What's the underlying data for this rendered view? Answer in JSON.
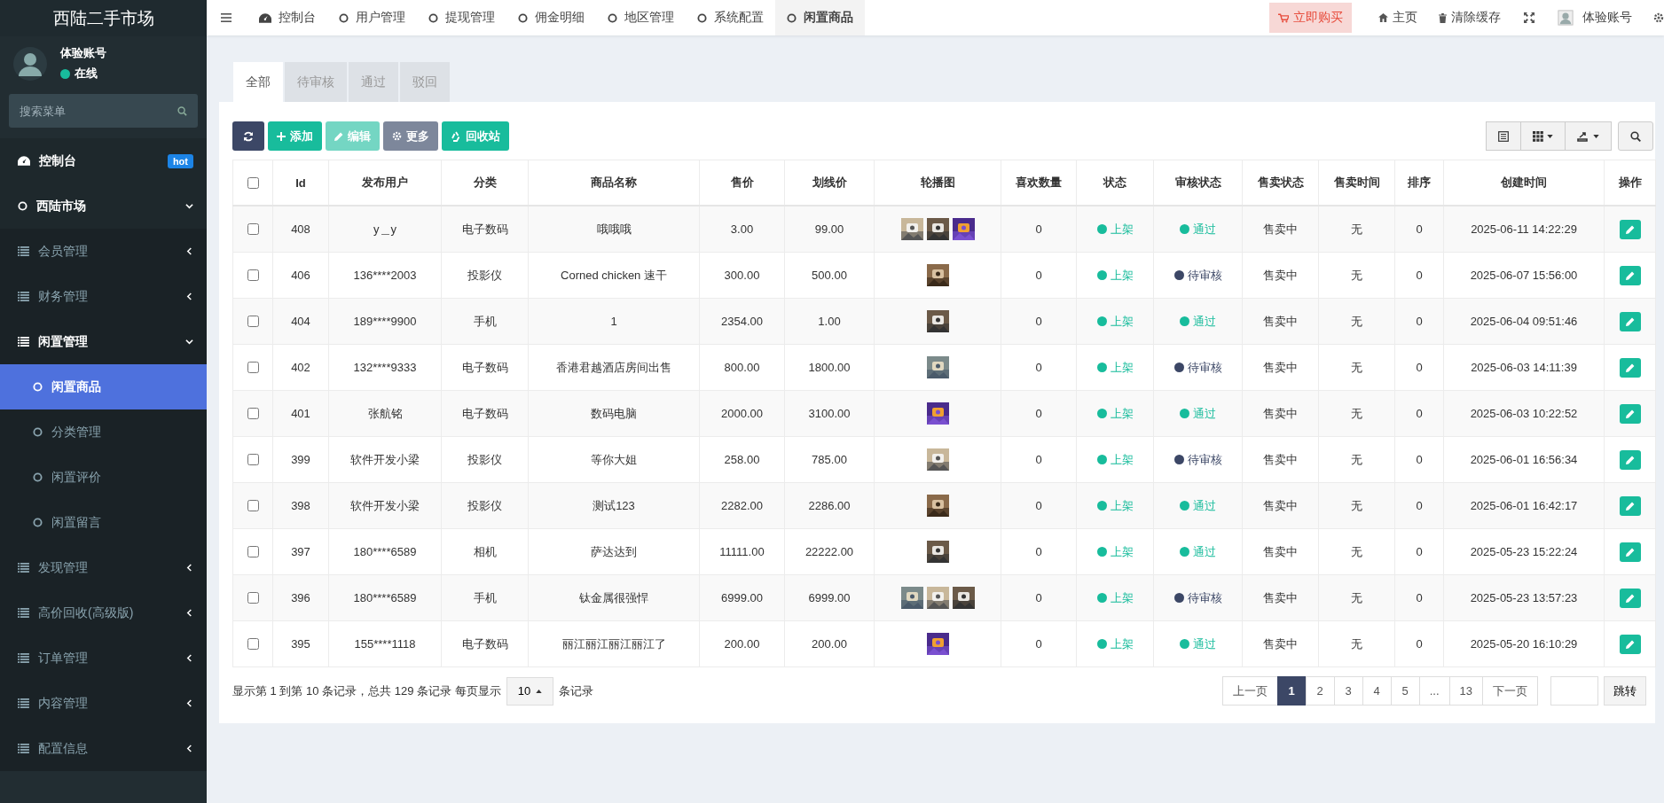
{
  "sidebar": {
    "brand": "西陆二手市场",
    "user": {
      "name": "体验账号",
      "status": "在线",
      "online": true
    },
    "search": {
      "placeholder": "搜索菜单"
    },
    "items": [
      {
        "label": "控制台",
        "badge": "hot",
        "selected": false
      },
      {
        "label": "西陆市场",
        "expanded": true,
        "selected": false,
        "children": [
          {
            "label": "会员管理",
            "expanded": false,
            "selected": false
          },
          {
            "label": "财务管理",
            "expanded": false,
            "selected": false
          },
          {
            "label": "闲置管理",
            "expanded": true,
            "selected": false,
            "children": [
              {
                "label": "闲置商品",
                "selected": true
              },
              {
                "label": "分类管理",
                "selected": false
              },
              {
                "label": "闲置评价",
                "selected": false
              },
              {
                "label": "闲置留言",
                "selected": false
              }
            ]
          },
          {
            "label": "发现管理",
            "expanded": false,
            "selected": false
          },
          {
            "label": "高价回收(高级版)",
            "expanded": false,
            "selected": false
          },
          {
            "label": "订单管理",
            "expanded": false,
            "selected": false
          },
          {
            "label": "内容管理",
            "expanded": false,
            "selected": false
          },
          {
            "label": "配置信息",
            "expanded": false,
            "selected": false
          }
        ]
      }
    ]
  },
  "top_nav": {
    "tabs": [
      {
        "label": "控制台",
        "selected": false
      },
      {
        "label": "用户管理",
        "selected": false
      },
      {
        "label": "提现管理",
        "selected": false
      },
      {
        "label": "佣金明细",
        "selected": false
      },
      {
        "label": "地区管理",
        "selected": false
      },
      {
        "label": "系统配置",
        "selected": false
      },
      {
        "label": "闲置商品",
        "selected": true
      }
    ],
    "buy_button": "立即购买",
    "home": "主页",
    "clear_cache": "清除缓存",
    "account": "体验账号"
  },
  "filter_tabs": [
    {
      "label": "全部",
      "selected": true
    },
    {
      "label": "待审核",
      "selected": false
    },
    {
      "label": "通过",
      "selected": false
    },
    {
      "label": "驳回",
      "selected": false
    }
  ],
  "toolbar": [
    {
      "kind": "refresh",
      "disabled": false
    },
    {
      "kind": "add",
      "label": "添加",
      "disabled": false
    },
    {
      "kind": "edit",
      "label": "编辑",
      "disabled": true
    },
    {
      "kind": "more",
      "label": "更多",
      "disabled": false
    },
    {
      "kind": "recycle",
      "label": "回收站",
      "disabled": false
    }
  ],
  "table": {
    "select_all": false,
    "columns": [
      "Id",
      "发布用户",
      "分类",
      "商品名称",
      "售价",
      "划线价",
      "轮播图",
      "喜欢数量",
      "状态",
      "审核状态",
      "售卖状态",
      "售卖时间",
      "排序",
      "创建时间",
      "操作"
    ],
    "rows": [
      {
        "checked": false,
        "id": "408",
        "user": "y＿y",
        "category": "电子数码",
        "name": "哦哦哦",
        "price": "3.00",
        "original_price": "99.00",
        "likes": "0",
        "status": {
          "text": "上架",
          "color": "#18bc9c"
        },
        "audit": {
          "text": "通过",
          "color": "#18bc9c"
        },
        "sale_status": "售卖中",
        "sale_time": "无",
        "sort": "0",
        "created": "2025-06-11 14:22:29"
      },
      {
        "checked": false,
        "id": "406",
        "user": "136****2003",
        "category": "投影仪",
        "name": "Corned chicken 速干",
        "price": "300.00",
        "original_price": "500.00",
        "likes": "0",
        "status": {
          "text": "上架",
          "color": "#18bc9c"
        },
        "audit": {
          "text": "待审核",
          "color": "#3c4766"
        },
        "sale_status": "售卖中",
        "sale_time": "无",
        "sort": "0",
        "created": "2025-06-07 15:56:00"
      },
      {
        "checked": false,
        "id": "404",
        "user": "189****9900",
        "category": "手机",
        "name": "1",
        "price": "2354.00",
        "original_price": "1.00",
        "likes": "0",
        "status": {
          "text": "上架",
          "color": "#18bc9c"
        },
        "audit": {
          "text": "通过",
          "color": "#18bc9c"
        },
        "sale_status": "售卖中",
        "sale_time": "无",
        "sort": "0",
        "created": "2025-06-04 09:51:46"
      },
      {
        "checked": false,
        "id": "402",
        "user": "132****9333",
        "category": "电子数码",
        "name": "香港君越酒店房间出售",
        "price": "800.00",
        "original_price": "1800.00",
        "likes": "0",
        "status": {
          "text": "上架",
          "color": "#18bc9c"
        },
        "audit": {
          "text": "待审核",
          "color": "#3c4766"
        },
        "sale_status": "售卖中",
        "sale_time": "无",
        "sort": "0",
        "created": "2025-06-03 14:11:39"
      },
      {
        "checked": false,
        "id": "401",
        "user": "张航铭",
        "category": "电子数码",
        "name": "数码电脑",
        "price": "2000.00",
        "original_price": "3100.00",
        "likes": "0",
        "status": {
          "text": "上架",
          "color": "#18bc9c"
        },
        "audit": {
          "text": "通过",
          "color": "#18bc9c"
        },
        "sale_status": "售卖中",
        "sale_time": "无",
        "sort": "0",
        "created": "2025-06-03 10:22:52"
      },
      {
        "checked": false,
        "id": "399",
        "user": "软件开发小梁",
        "category": "投影仪",
        "name": "等你大姐",
        "price": "258.00",
        "original_price": "785.00",
        "likes": "0",
        "status": {
          "text": "上架",
          "color": "#18bc9c"
        },
        "audit": {
          "text": "待审核",
          "color": "#3c4766"
        },
        "sale_status": "售卖中",
        "sale_time": "无",
        "sort": "0",
        "created": "2025-06-01 16:56:34"
      },
      {
        "checked": false,
        "id": "398",
        "user": "软件开发小梁",
        "category": "投影仪",
        "name": "测试123",
        "price": "2282.00",
        "original_price": "2286.00",
        "likes": "0",
        "status": {
          "text": "上架",
          "color": "#18bc9c"
        },
        "audit": {
          "text": "通过",
          "color": "#18bc9c"
        },
        "sale_status": "售卖中",
        "sale_time": "无",
        "sort": "0",
        "created": "2025-06-01 16:42:17"
      },
      {
        "checked": false,
        "id": "397",
        "user": "180****6589",
        "category": "相机",
        "name": "萨达达到",
        "price": "11111.00",
        "original_price": "22222.00",
        "likes": "0",
        "status": {
          "text": "上架",
          "color": "#18bc9c"
        },
        "audit": {
          "text": "通过",
          "color": "#18bc9c"
        },
        "sale_status": "售卖中",
        "sale_time": "无",
        "sort": "0",
        "created": "2025-05-23 15:22:24"
      },
      {
        "checked": false,
        "id": "396",
        "user": "180****6589",
        "category": "手机",
        "name": "钛金属很强悍",
        "price": "6999.00",
        "original_price": "6999.00",
        "likes": "0",
        "status": {
          "text": "上架",
          "color": "#18bc9c"
        },
        "audit": {
          "text": "待审核",
          "color": "#3c4766"
        },
        "sale_status": "售卖中",
        "sale_time": "无",
        "sort": "0",
        "created": "2025-05-23 13:57:23"
      },
      {
        "checked": false,
        "id": "395",
        "user": "155****1118",
        "category": "电子数码",
        "name": "丽江丽江丽江丽江了",
        "price": "200.00",
        "original_price": "200.00",
        "likes": "0",
        "status": {
          "text": "上架",
          "color": "#18bc9c"
        },
        "audit": {
          "text": "通过",
          "color": "#18bc9c"
        },
        "sale_status": "售卖中",
        "sale_time": "无",
        "sort": "0",
        "created": "2025-05-20 16:10:29"
      }
    ]
  },
  "footer": {
    "summary_before": "显示第 1 到第 10 条记录，总共 129 条记录 每页显示",
    "page_size": "10",
    "summary_after": "条记录"
  },
  "pagination": {
    "prev": "上一页",
    "pages": [
      {
        "label": "1",
        "selected": true
      },
      {
        "label": "2",
        "selected": false
      },
      {
        "label": "3",
        "selected": false
      },
      {
        "label": "4",
        "selected": false
      },
      {
        "label": "5",
        "selected": false
      },
      {
        "label": "...",
        "selected": false
      },
      {
        "label": "13",
        "selected": false
      }
    ],
    "next": "下一页",
    "jump": "跳转"
  }
}
